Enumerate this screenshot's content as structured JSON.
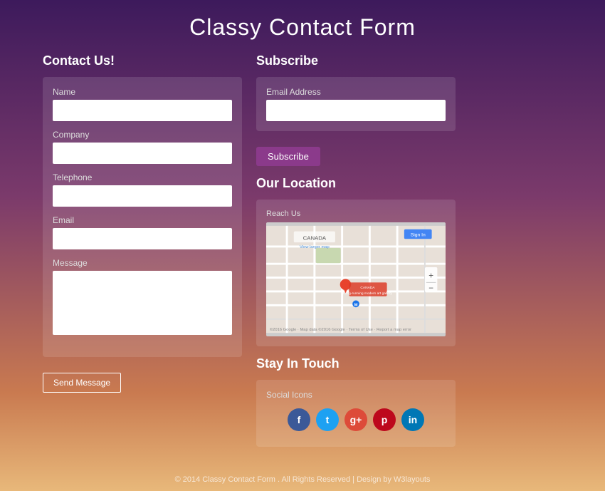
{
  "page": {
    "title": "Classy Contact Form"
  },
  "contact": {
    "section_title": "Contact Us!",
    "fields": {
      "name_label": "Name",
      "name_placeholder": "",
      "company_label": "Company",
      "company_placeholder": "",
      "telephone_label": "Telephone",
      "telephone_placeholder": "",
      "email_label": "Email",
      "email_placeholder": "",
      "message_label": "Message",
      "message_placeholder": ""
    },
    "send_button": "Send Message"
  },
  "subscribe": {
    "section_title": "Subscribe",
    "email_label": "Email Address",
    "email_placeholder": "",
    "subscribe_button": "Subscribe"
  },
  "location": {
    "section_title": "Our Location",
    "panel_label": "Reach Us"
  },
  "social": {
    "section_title": "Stay In Touch",
    "panel_label": "Social Icons",
    "icons": [
      {
        "name": "facebook",
        "symbol": "f",
        "class": "si-facebook"
      },
      {
        "name": "twitter",
        "symbol": "t",
        "class": "si-twitter"
      },
      {
        "name": "google-plus",
        "symbol": "g+",
        "class": "si-google"
      },
      {
        "name": "pinterest",
        "symbol": "p",
        "class": "si-pinterest"
      },
      {
        "name": "linkedin",
        "symbol": "in",
        "class": "si-linkedin"
      }
    ]
  },
  "footer": {
    "text": "© 2014 Classy Contact Form . All Rights Reserved | Design by W3layouts"
  }
}
